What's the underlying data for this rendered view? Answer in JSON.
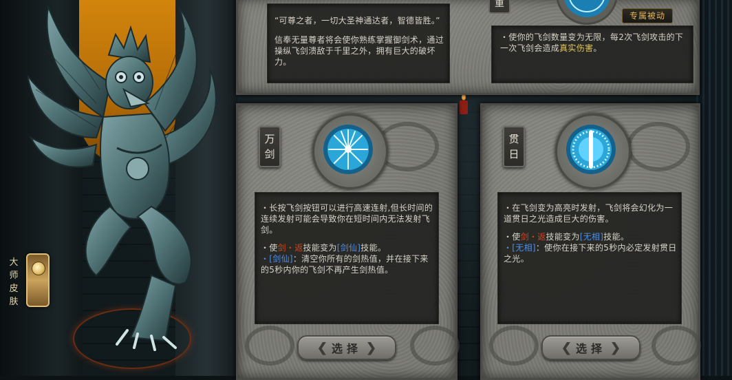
{
  "master_skin": {
    "label": "大师皮肤"
  },
  "top_card": {
    "tag": "重",
    "quote": "“可尊之者，一切大圣神通达者，智德皆胜。”",
    "lore": "信奉无量尊者将会使你熟练掌握御剑术，通过操纵飞剑溃敌于千里之外，拥有巨大的破坏力。",
    "passive_label": "专属被动",
    "passive_text_a": "・使你的飞剑数量变为无限，每2次飞剑攻击的下一次飞剑会造成",
    "passive_highlight": "真实伤害",
    "passive_text_b": "。"
  },
  "card_wanjian": {
    "tag": "万剑",
    "line1": "・长按飞剑按钮可以进行高速连射,但长时间的连续发射可能会导致你在短时间内无法发射飞剑。",
    "line2_a": "・使",
    "line2_hl1": "剑・返",
    "line2_b": "技能变为",
    "line2_hl2": "[剑仙]",
    "line2_c": "技能。",
    "line3_hl": "・[剑仙]",
    "line3_text": "：清空你所有的剑热值，并在接下来的5秒内你的飞剑不再产生剑热值。",
    "select_label": "选择"
  },
  "card_guanri": {
    "tag": "贯日",
    "line1": "・在飞剑变为高亮时发射，飞剑将会幻化为一道贯日之光造成巨大的伤害。",
    "line2_a": "・使",
    "line2_hl1": "剑・返",
    "line2_b": "技能变为",
    "line2_hl2": "[无相]",
    "line2_c": "技能。",
    "line3_hl": "・[无相]",
    "line3_text": "：使你在接下来的5秒内必定发射贯日之光。",
    "select_label": "选择"
  },
  "colors": {
    "highlight_red": "#d2451c",
    "highlight_blue": "#4d8fe8",
    "highlight_yellow": "#e0c65a",
    "emblem_glow": "#5fd2ff"
  },
  "icons": [
    "myriad-swords-emblem-icon",
    "piercing-sun-emblem-icon",
    "skin-gem-icon",
    "arrow-left-icon",
    "arrow-right-icon"
  ]
}
